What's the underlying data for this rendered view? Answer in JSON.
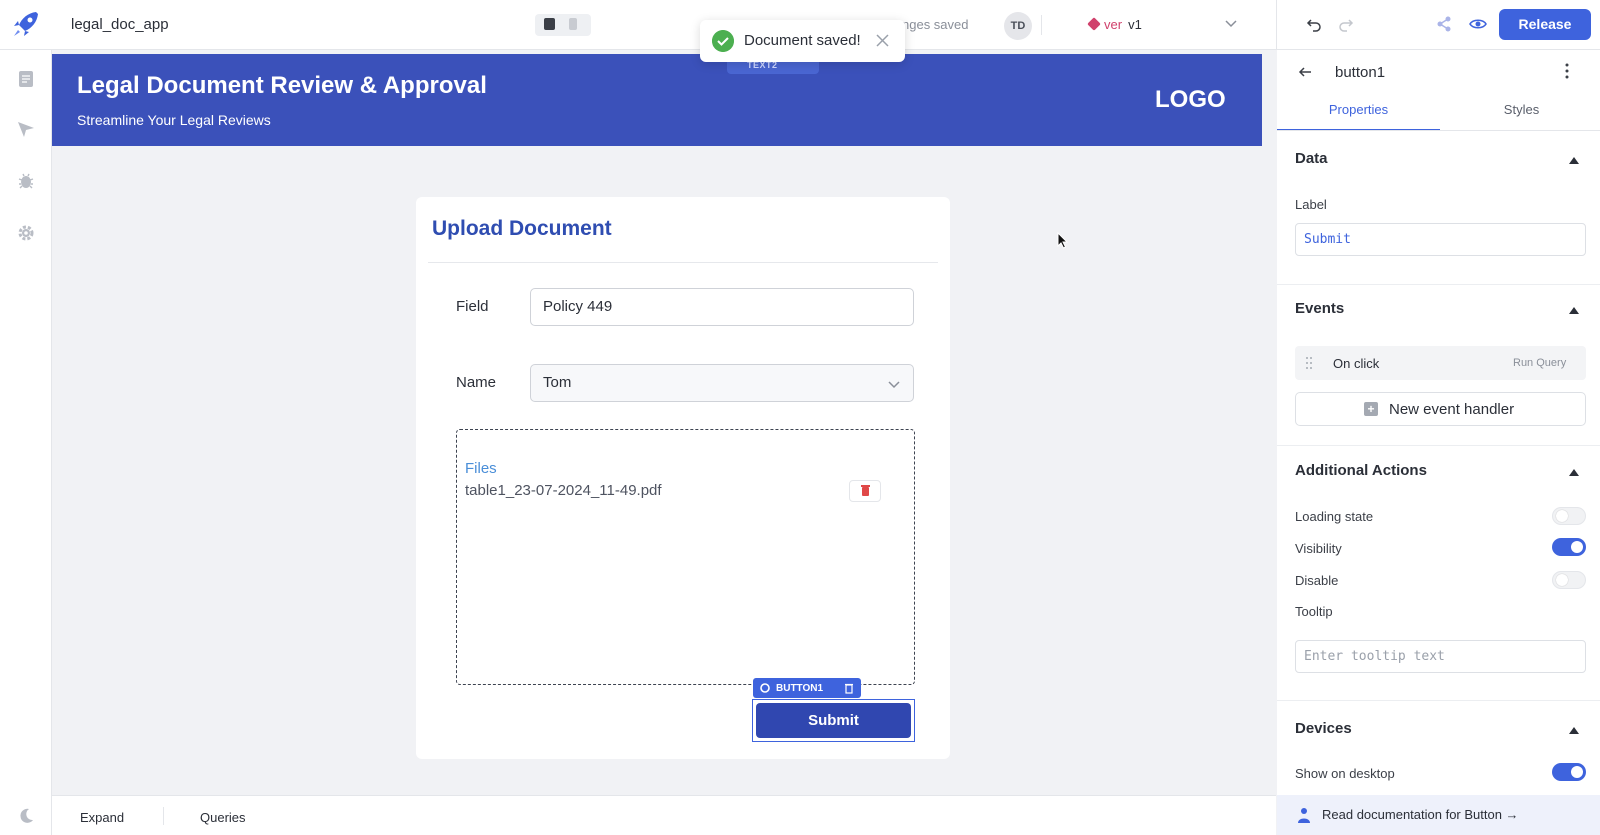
{
  "app": {
    "name": "legal_doc_app"
  },
  "topbar": {
    "changes_saved": "nges saved",
    "avatar_initials": "TD",
    "version_label": "ver",
    "version_value": "v1",
    "release_label": "Release"
  },
  "toast": {
    "message": "Document saved!"
  },
  "header": {
    "title": "Legal Document Review & Approval",
    "subtitle": "Streamline Your Legal Reviews",
    "logo_text": "LOGO",
    "selected_tag": "TEXT2"
  },
  "form": {
    "title": "Upload Document",
    "field_label": "Field",
    "field_value": "Policy 449",
    "name_label": "Name",
    "name_value": "Tom",
    "files_label": "Files",
    "file_name": "table1_23-07-2024_11-49.pdf",
    "button_tag": "BUTTON1",
    "submit_label": "Submit"
  },
  "bottombar": {
    "expand": "Expand",
    "queries": "Queries"
  },
  "inspector": {
    "component_name": "button1",
    "tabs": [
      {
        "label": "Properties",
        "active": true
      },
      {
        "label": "Styles",
        "active": false
      }
    ],
    "data_section": "Data",
    "label_label": "Label",
    "label_value": "Submit",
    "events_section": "Events",
    "event_name": "On click",
    "event_action": "Run Query",
    "new_event_label": "New event handler",
    "additional_section": "Additional Actions",
    "toggles": [
      {
        "label": "Loading state",
        "on": false
      },
      {
        "label": "Visibility",
        "on": true
      },
      {
        "label": "Disable",
        "on": false
      }
    ],
    "tooltip_label": "Tooltip",
    "tooltip_placeholder": "Enter tooltip text",
    "devices_section": "Devices",
    "show_desktop_label": "Show on desktop",
    "show_desktop_on": true,
    "docs_link": "Read documentation for Button →"
  },
  "colors": {
    "accent": "#3e63dd",
    "header_band": "#3b51ba",
    "form_title": "#2f4db1",
    "success": "#4caf50",
    "version": "#d0416c"
  }
}
